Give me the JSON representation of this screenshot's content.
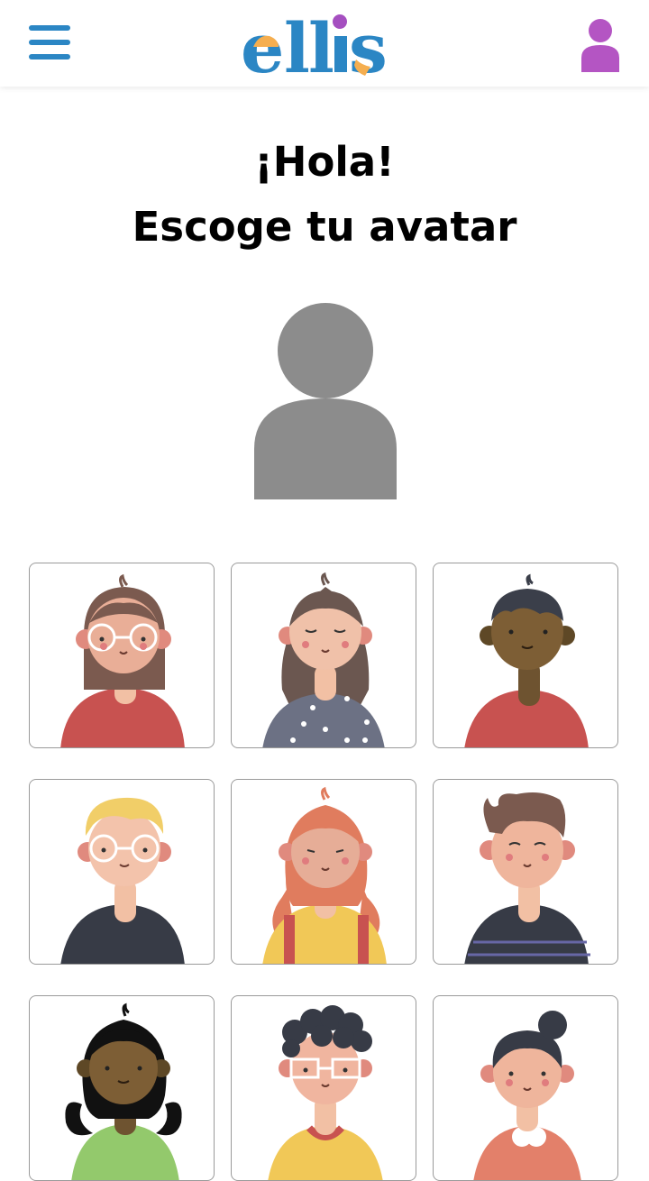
{
  "header": {
    "logo_text": [
      "e",
      "l",
      "l",
      "i",
      "s"
    ],
    "menu_icon": "hamburger-menu-icon",
    "profile_icon": "user-profile-icon"
  },
  "main": {
    "greeting": "¡Hola!",
    "subtitle": "Escoge tu avatar",
    "selected_avatar_icon": "placeholder-user-icon"
  },
  "avatars": [
    {
      "name": "avatar-girl-glasses-red-sweater"
    },
    {
      "name": "avatar-girl-long-hair-dotted-sweater"
    },
    {
      "name": "avatar-boy-dark-skin-red-sweater"
    },
    {
      "name": "avatar-boy-blond-glasses"
    },
    {
      "name": "avatar-girl-red-curly-hair"
    },
    {
      "name": "avatar-boy-brown-hair-striped"
    },
    {
      "name": "avatar-girl-black-curly-hair"
    },
    {
      "name": "avatar-boy-curly-glasses"
    },
    {
      "name": "avatar-girl-bun-orange"
    }
  ],
  "colors": {
    "logo_blue": "#2b86c4",
    "logo_orange": "#f5ae4f",
    "logo_purple": "#a54fc0",
    "menu_blue": "#2b86c4",
    "profile_purple": "#b455c3",
    "placeholder_gray": "#8c8c8c"
  }
}
